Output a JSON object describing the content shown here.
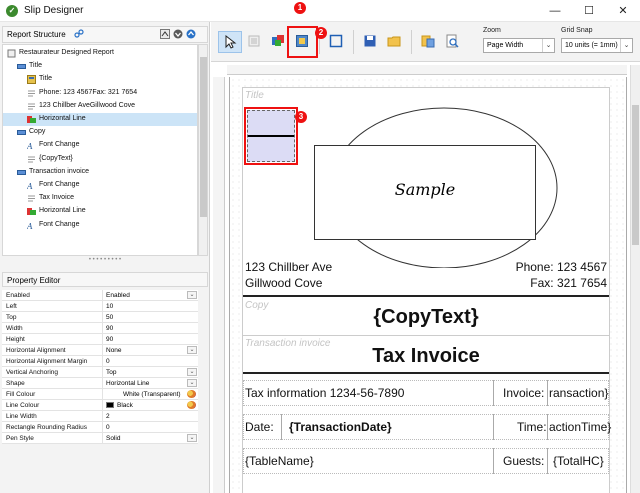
{
  "window": {
    "title": "Slip Designer",
    "minimize": "—",
    "maximize": "☐",
    "close": "✕"
  },
  "report_structure": {
    "title": "Report Structure",
    "items": [
      {
        "label": "Restaurateur Designed Report",
        "icon": "report-icon"
      },
      {
        "label": "Title",
        "icon": "section-icon"
      },
      {
        "label": "Title",
        "icon": "title-icon"
      },
      {
        "label": "Phone: 123 4567Fax: 321 7654",
        "icon": "text-icon"
      },
      {
        "label": "123 Chillber AveGillwood Cove",
        "icon": "text-icon"
      },
      {
        "label": "Horizontal Line",
        "icon": "horizontal-line-icon"
      },
      {
        "label": "Copy",
        "icon": "section-icon"
      },
      {
        "label": "Font Change",
        "icon": "font-change-icon"
      },
      {
        "label": "{CopyText}",
        "icon": "text-icon"
      },
      {
        "label": "Transaction invoice",
        "icon": "section-icon"
      },
      {
        "label": "Font Change",
        "icon": "font-change-icon"
      },
      {
        "label": "Tax Invoice",
        "icon": "text-icon"
      },
      {
        "label": "Horizontal Line",
        "icon": "horizontal-line-icon"
      },
      {
        "label": "Font Change",
        "icon": "font-change-icon"
      }
    ],
    "selected_index": 5
  },
  "property_editor": {
    "title": "Property Editor",
    "rows": [
      {
        "name": "Enabled",
        "value": "Enabled",
        "dropdown": true
      },
      {
        "name": "Left",
        "value": "10"
      },
      {
        "name": "Top",
        "value": "50"
      },
      {
        "name": "Width",
        "value": "90"
      },
      {
        "name": "Height",
        "value": "90"
      },
      {
        "name": "Horizontal Alignment",
        "value": "None",
        "dropdown": true
      },
      {
        "name": "Horizontal Alignment Margin",
        "value": "0"
      },
      {
        "name": "Vertical Anchoring",
        "value": "Top",
        "dropdown": true
      },
      {
        "name": "Shape",
        "value": "Horizontal Line",
        "dropdown": true
      },
      {
        "name": "Fill Colour",
        "value": "White (Transparent)",
        "swatch": "#ffffff",
        "picker": true
      },
      {
        "name": "Line Colour",
        "value": "Black",
        "swatch": "#000000",
        "picker": true
      },
      {
        "name": "Line Width",
        "value": "2"
      },
      {
        "name": "Rectangle Rounding Radius",
        "value": "0"
      },
      {
        "name": "Pen Style",
        "value": "Solid",
        "dropdown": true
      }
    ]
  },
  "toolbar": {
    "zoom_label": "Zoom",
    "zoom_value": "Page Width",
    "grid_snap_label": "Grid Snap",
    "grid_snap_value": "10 units (= 1mm)"
  },
  "callouts": [
    "1",
    "2",
    "3"
  ],
  "report": {
    "title_section": "Title",
    "sample_text": "Sample",
    "address_line1": "123 Chillber Ave",
    "address_line2": "Gillwood Cove",
    "phone": "Phone: 123 4567",
    "fax": "Fax: 321 7654",
    "copy_section": "Copy",
    "copy_text": "{CopyText}",
    "transaction_section": "Transaction invoice",
    "tax_invoice": "Tax Invoice",
    "tax_info": "Tax information 1234-56-7890",
    "invoice_label": "Invoice:",
    "invoice_value": "ransaction}",
    "date_label": "Date:",
    "date_value": "{TransactionDate}",
    "time_label": "Time:",
    "time_value": "actionTime}",
    "table_name": "{TableName}",
    "guests_label": "Guests:",
    "guests_value": "{TotalHC}"
  },
  "colors": {
    "highlight": "#ee1111",
    "selection": "#cce4f7",
    "shape_fill": "#dcdcf5"
  }
}
